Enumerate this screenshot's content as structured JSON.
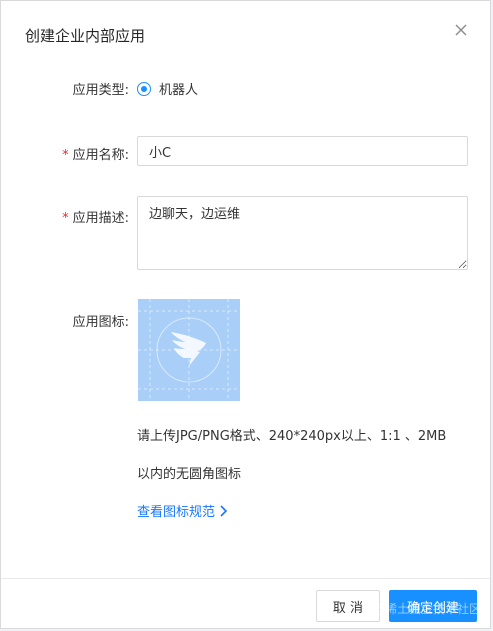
{
  "dialog": {
    "title": "创建企业内部应用",
    "close_icon": "close-icon"
  },
  "form": {
    "type": {
      "label": "应用类型:",
      "option": "机器人"
    },
    "name": {
      "required_mark": "*",
      "label": "应用名称:",
      "value": "小C"
    },
    "description": {
      "required_mark": "*",
      "label": "应用描述:",
      "value": "边聊天，边运维"
    },
    "icon": {
      "label": "应用图标:",
      "hint_line1": "请上传JPG/PNG格式、240*240px以上、1:1 、2MB",
      "hint_line2": "以内的无圆角图标",
      "guide_link": "查看图标规范"
    }
  },
  "footer": {
    "cancel_label": "取 消",
    "ok_label": "确定创建",
    "watermark": "@稀土掘金技术社区"
  },
  "colors": {
    "accent": "#1890ff",
    "required": "#f5222d",
    "icon_bg": "#a9cff8"
  }
}
